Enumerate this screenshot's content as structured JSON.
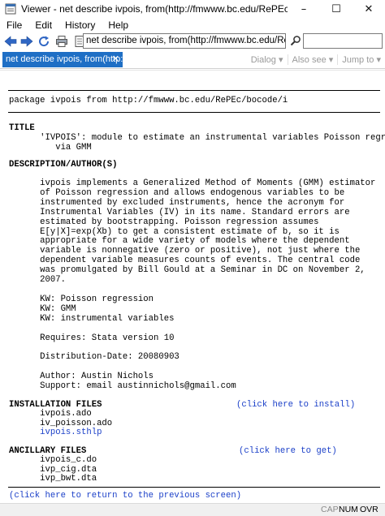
{
  "window": {
    "title": "Viewer - net describe ivpois, from(http://fmwww.bc.edu/RePEc/bocode/i)",
    "minimize": "–",
    "maximize": "☐",
    "close": "✕"
  },
  "menu": [
    "File",
    "Edit",
    "History",
    "Help"
  ],
  "toolbar": {
    "url": "net describe ivpois, from(http://fmwww.bc.edu/RePEc/bocode/i)",
    "find_value": ""
  },
  "tab": {
    "label": "net describe ivpois, from(http://fm...",
    "close": "✕"
  },
  "tab_tools": [
    "Dialog ▾",
    "Also see ▾",
    "Jump to ▾"
  ],
  "doc": {
    "package_line": "package ivpois from http://fmwww.bc.edu/RePEc/bocode/i",
    "title_heading": "TITLE",
    "title_text": "      'IVPOIS': module to estimate an instrumental variables Poisson regression\n         via GMM",
    "desc_heading": "DESCRIPTION/AUTHOR(S)",
    "desc_text": "      ivpois implements a Generalized Method of Moments (GMM) estimator\n      of Poisson regression and allows endogenous variables to be\n      instrumented by excluded instruments, hence the acronym for\n      Instrumental Variables (IV) in its name. Standard errors are\n      estimated by bootstrapping. Poisson regression assumes\n      E[y|X]=exp(Xb) to get a consistent estimate of b, so it is\n      appropriate for a wide variety of models where the dependent\n      variable is nonnegative (zero or positive), not just where the\n      dependent variable measures counts of events. The central code\n      was promulgated by Bill Gould at a Seminar in DC on November 2,\n      2007.\n\n      KW: Poisson regression\n      KW: GMM\n      KW: instrumental variables\n\n      Requires: Stata version 10\n\n      Distribution-Date: 20080903\n\n      Author: Austin Nichols\n      Support: email austinnichols@gmail.com",
    "install_heading": "INSTALLATION FILES",
    "install_link": "(click here to install)",
    "install_files": [
      "      ivpois.ado",
      "      iv_poisson.ado"
    ],
    "install_help_link": "      ivpois.sthlp",
    "ancillary_heading": "ANCILLARY FILES",
    "ancillary_link": "(click here to get)",
    "ancillary_files": [
      "      ivpois_c.do",
      "      ivp_cig.dta",
      "      ivp_bwt.dta"
    ],
    "return_link": "(click here to return to the previous screen)"
  },
  "status": {
    "cap": "CAP",
    "num": "NUM",
    "ovr": "OVR"
  }
}
